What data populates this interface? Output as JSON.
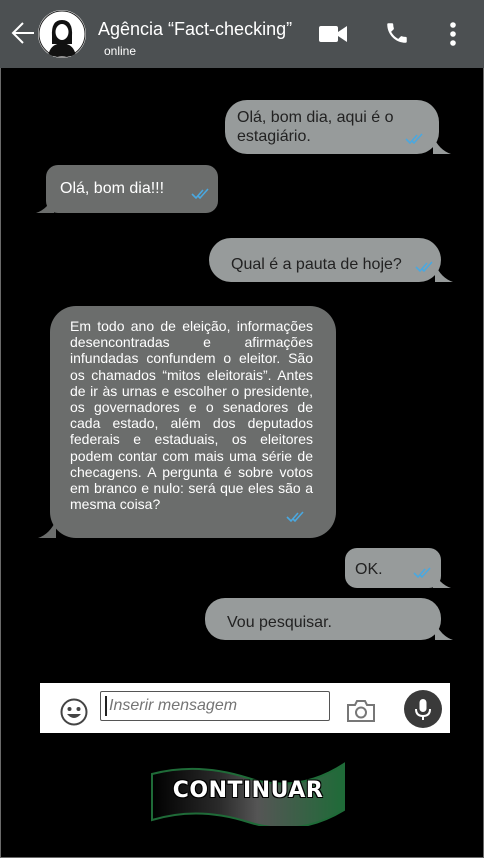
{
  "header": {
    "title": "Agência “Fact-checking”",
    "status": "online",
    "bg_color": "#4c5052"
  },
  "icons": {
    "back": "arrow-left-icon",
    "video": "video-camera-icon",
    "phone": "phone-icon",
    "menu": "more-vertical-icon",
    "emoji": "emoji-icon",
    "camera": "camera-icon",
    "mic": "microphone-icon",
    "read": "double-check-icon"
  },
  "messages": [
    {
      "side": "right",
      "text": "Olá, bom dia, aqui é o estagiário."
    },
    {
      "side": "left",
      "text": "Olá, bom dia!!!"
    },
    {
      "side": "right",
      "text": "Qual é a pauta de hoje?"
    },
    {
      "side": "left",
      "text": "Em todo ano de eleição, informações desencontradas e afirmações infundadas confundem o eleitor. São os chamados “mitos eleitorais”. Antes de ir às urnas e escolher o presidente, os governadores e o senadores de cada estado, além dos deputados federais e estaduais, os eleitores podem contar com mais uma série de checagens. A pergunta é sobre votos em branco e nulo: será que eles são a mesma coisa?"
    },
    {
      "side": "right",
      "text": "OK."
    },
    {
      "side": "right",
      "text": "Vou pesquisar."
    }
  ],
  "composer": {
    "placeholder": "Inserir mensagem"
  },
  "continue_button": {
    "label": "CONTINUAR"
  },
  "colors": {
    "right_bubble": "#979b9b",
    "left_bubble": "#6b6d6c",
    "check": "#4aa8e0",
    "banner_green": "#1f6b38"
  }
}
